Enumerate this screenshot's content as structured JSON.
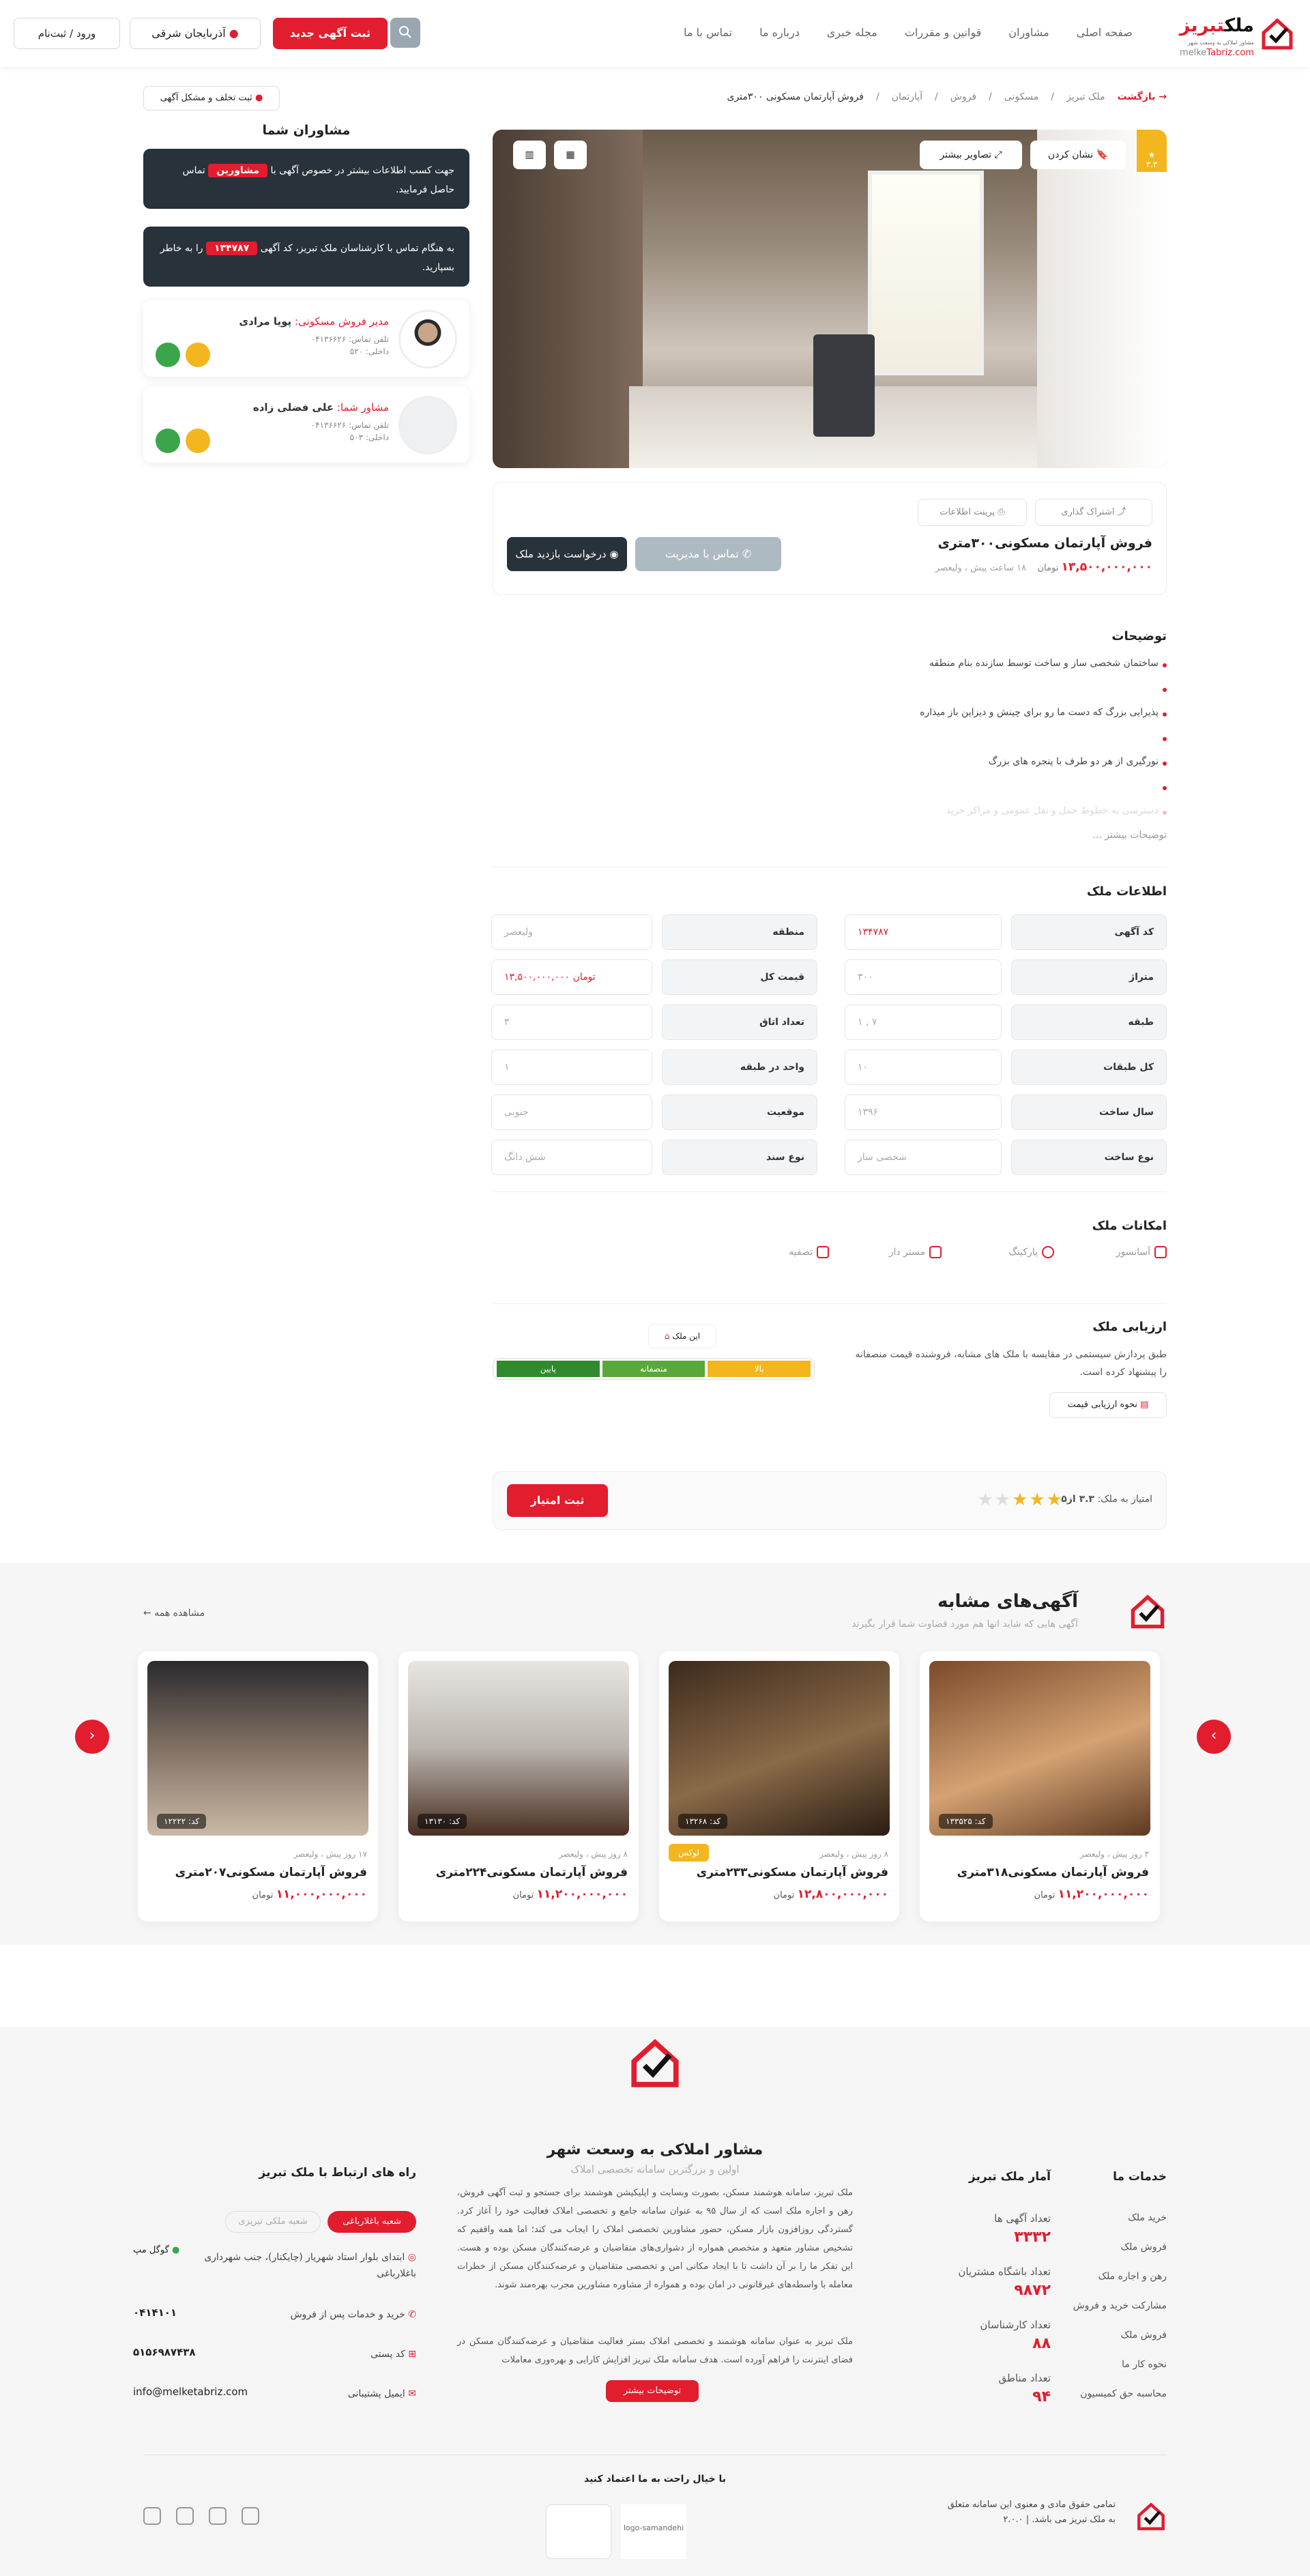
{
  "header": {
    "logo_text_a": "ملک",
    "logo_text_b": "تبریز",
    "logo_sub": "مشاور املاکی به وسعت شهر",
    "logo_url_a": "melke",
    "logo_url_b": "Tabriz.com",
    "nav": [
      "صفحه اصلی",
      "مشاوران",
      "قوانین و مقررات",
      "مجله خبری",
      "درباره ما",
      "تماس با ما"
    ],
    "new_ad": "ثبت آگهی جدید",
    "branch": "آذربایجان شرقی",
    "login": "ورود / ثبت‌نام"
  },
  "breadcrumb": {
    "back": "بازگشت",
    "items": [
      "ملک تبریز",
      "مسکونی",
      "فروش",
      "آپارتمان"
    ],
    "current": "فروش آپارتمان مسکونی ۳۰۰متری"
  },
  "report": "ثبت تخلف و مشکل آگهی",
  "hero": {
    "bookmark": "نشان کردن",
    "gallery": "تصاویر بیشتر",
    "badge": "۳.۳"
  },
  "info": {
    "share": "اشتراک گذاری",
    "print": "پرینت اطلاعات",
    "title": "فروش آپارتمان مسکونی۳۰۰متری",
    "price": "۱۳,۵۰۰,۰۰۰,۰۰۰",
    "price_unit": "تومان",
    "meta": "۱۸ ساعت پیش ، ولیعصر",
    "contact_mgr": "تماس با مدیریت",
    "visit": "درخواست بازدید ملک"
  },
  "advisers": {
    "title": "مشاوران شما",
    "box1_a": "جهت کسب اطلاعات بیشتر در خصوص آگهی با",
    "box1_tag": "مشاورین",
    "box1_b": "تماس حاصل فرمایید.",
    "box2_a": "به هنگام تماس با کارشناسان ملک تبریز، کد آگهی",
    "box2_tag": "۱۳۴۷۸۷",
    "box2_b": "را به خاطر بسپارید.",
    "cards": [
      {
        "role": "مدیر فروش مسکونی:",
        "name": "پویا مرادی",
        "phone": "تلفن تماس: ۰۴۱۳۶۶۲۶",
        "ext": "داخلی: ۵۲۰"
      },
      {
        "role": "مشاور شما:",
        "name": "علی فضلی زاده",
        "phone": "تلفن تماس: ۰۴۱۳۶۶۲۶",
        "ext": "داخلی: ۵۰۳"
      }
    ]
  },
  "description": {
    "title": "توضیحات",
    "items": [
      "ساختمان شخصی ساز و ساخت توسط سازنده بنام منطقه",
      "",
      "پذیرایی بزرگ که دست ما رو برای چینش و دیزاین باز میذاره",
      "",
      "نورگیری از هر دو طرف با پنجره های بزرگ",
      "",
      "دسترسی به خطوط حمل و نقل عمومی و مراکز خرید"
    ],
    "more": "توضیحات بیشتر ..."
  },
  "property": {
    "title": "اطلاعات ملک",
    "rows": [
      [
        {
          "k": "کد آگهی",
          "v": "۱۳۴۷۸۷",
          "red": true
        },
        {
          "k": "منطقه",
          "v": "ولیعصر"
        }
      ],
      [
        {
          "k": "متراژ",
          "v": "۳۰۰"
        },
        {
          "k": "قیمت کل",
          "v": "۱۳,۵۰۰,۰۰۰,۰۰۰ تومان",
          "red": true
        }
      ],
      [
        {
          "k": "طبقه",
          "v": "۱ , ۷"
        },
        {
          "k": "تعداد اتاق",
          "v": "۳"
        }
      ],
      [
        {
          "k": "کل طبقات",
          "v": "۱۰"
        },
        {
          "k": "واحد در طبقه",
          "v": "۱"
        }
      ],
      [
        {
          "k": "سال ساخت",
          "v": "۱۳۹۶"
        },
        {
          "k": "موقعیت",
          "v": "جنوبی"
        }
      ],
      [
        {
          "k": "نوع ساخت",
          "v": "شخصی ساز"
        },
        {
          "k": "نوع سند",
          "v": "شش دانگ"
        }
      ]
    ]
  },
  "amenities": {
    "title": "امکانات ملک",
    "items": [
      "آسانسور",
      "پارکینگ",
      "مستر دار",
      "تصفیه"
    ]
  },
  "valuation": {
    "title": "ارزیابی ملک",
    "text": "طبق پردازش سیستمی در مقایسه با ملک های مشابه، فروشنده قیمت منصفانه را پیشنهاد کرده است.",
    "button": "نحوه ارزیابی قیمت",
    "chip": "این ملک",
    "meter": [
      "پایین",
      "منصفانه",
      "بالا"
    ]
  },
  "rating": {
    "label": "امتیاز به ملک:",
    "value": "۳.۳ از۵",
    "stars": 3.3,
    "button": "ثبت امتیاز"
  },
  "similar": {
    "title": "آگهی‌های مشابه",
    "subtitle": "آگهی هایی که شاید انها هم مورد قضاوت شما قرار بگیرند",
    "see_all": "مشاهده همه",
    "cards": [
      {
        "code": "کد: ۱۳۳۵۲۵",
        "meta": "۳ روز پیش ، ولیعصر",
        "title": "فروش آپارتمان مسکونی۳۱۸متری",
        "price": "۱۱,۲۰۰,۰۰۰,۰۰۰",
        "unit": "تومان",
        "badge": ""
      },
      {
        "code": "کد: ۱۳۲۶۸",
        "meta": "۸ روز پیش ، ولیعصر",
        "title": "فروش آپارتمان مسکونی۲۳۳متری",
        "price": "۱۲,۸۰۰,۰۰۰,۰۰۰",
        "unit": "تومان",
        "badge": "لوکس"
      },
      {
        "code": "کد: ۱۳۱۳۰",
        "meta": "۸ روز پیش ، ولیعصر",
        "title": "فروش آپارتمان مسکونی۲۲۴متری",
        "price": "۱۱,۲۰۰,۰۰۰,۰۰۰",
        "unit": "تومان",
        "badge": ""
      },
      {
        "code": "کد: ۱۲۲۲۲",
        "meta": "۱۷ روز پیش ، ولیعصر",
        "title": "فروش آپارتمان مسکونی۲۰۷متری",
        "price": "۱۱,۰۰۰,۰۰۰,۰۰۰",
        "unit": "تومان",
        "badge": ""
      }
    ]
  },
  "footer": {
    "title": "مشاور املاکی به وسعت شهر",
    "subtitle": "اولین و بزرگترین سامانه تخصصی املاک",
    "para1": "ملک تبریز، سامانه هوشمند مسکن، بصورت وبسایت و اپلیکیشن هوشمند برای جستجو و ثبت آگهی فروش، رهن و اجاره ملک است که از سال ۹۵ به عنوان سامانه جامع و تخصصی املاک فعالیت خود را آغاز کرد. گستردگی روزافزون بازار مسکن، حضور مشاورین تخصصی املاک را ایجاب می کند؛ اما همه واقفیم که تشخیص مشاور متعهد و متخصص همواره از دشواری‌های متقاضیان و عرضه‌کنندگان مسکن بوده و هست. این تفکر ما را بر آن داشت تا با ایجاد مکانی امن و تخصصی متقاضیان و عرضه‌کنندگان مسکن از خطرات معامله با واسطه‌های غیرقانونی در امان بوده و همواره از مشاوره مشاورین مجرب بهره‌مند شوند.",
    "para2": "ملک تبریز به عنوان سامانه هوشمند و تخصصی املاک بستر فعالیت متقاضیان و عرضه‌کنندگان مسکن در فضای اینترنت را فراهم آورده است. هدف سامانه ملک تبریز افزایش کارایی و بهره‌وری معاملات",
    "more": "توضیحات بیشتر",
    "services_title": "خدمات ما",
    "services": [
      "خرید ملک",
      "فروش ملک",
      "رهن و اجاره ملک",
      "مشارکت خرید و فروش",
      "فروش ملک",
      "نحوه کار ما",
      "محاسبه حق کمیسیون"
    ],
    "stats_title": "آمار ملک تبریز",
    "stats": [
      {
        "label": "تعداد آگهی ها",
        "value": "۳۳۳۲"
      },
      {
        "label": "تعداد باشگاه مشتریان",
        "value": "۹۸۷۲"
      },
      {
        "label": "تعداد کارشناسان",
        "value": "۸۸"
      },
      {
        "label": "تعداد مناطق",
        "value": "۹۴"
      }
    ],
    "contact_title": "راه های ارتباط با ملک تبریز",
    "branch_active": "شعبه باغلارباغی",
    "branch_other": "شعبه ملکی تبریزی",
    "address": "ابتدای بلوار استاد شهریار (چایکنار)، جنب شهرداری باغلارباغی",
    "map": "گوگل مپ",
    "rows": [
      {
        "label": "خرید و خدمات پس از فروش",
        "value": "۰۴۱۴۱۰۱"
      },
      {
        "label": "کد پستی",
        "value": "۵۱۵۶۹۸۷۴۳۸"
      },
      {
        "label": "ایمیل پشتیبانی",
        "value": "info@melketabriz.com"
      }
    ],
    "trust_title": "با خیال راحت به ما اعتماد کنید",
    "trust_logo_alt": "logo-samandehi",
    "copyright": "تمامی حقوق مادی و معنوی این سامانه متعلق به ملک تبریز می باشد. | ۲.۰.۰"
  },
  "colors": {
    "accent": "#e11d2e",
    "dark": "#28323a",
    "green": "#2f8a2e",
    "mid_green": "#5aa83a",
    "yellow": "#f3b61f"
  }
}
